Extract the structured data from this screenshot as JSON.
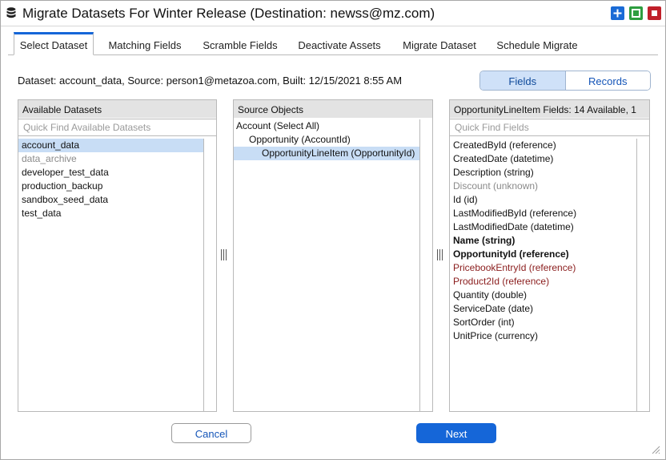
{
  "window": {
    "title": "Migrate Datasets For Winter Release (Destination: newss@mz.com)",
    "controls": {
      "plus": "+",
      "maximize": "maximize",
      "close": "close"
    }
  },
  "tabs": [
    {
      "label": "Select Dataset",
      "active": true
    },
    {
      "label": "Matching Fields",
      "active": false
    },
    {
      "label": "Scramble Fields",
      "active": false
    },
    {
      "label": "Deactivate Assets",
      "active": false
    },
    {
      "label": "Migrate Dataset",
      "active": false
    },
    {
      "label": "Schedule Migrate",
      "active": false
    }
  ],
  "dataset_info": "Dataset: account_data, Source: person1@metazoa.com, Built: 12/15/2021 8:55 AM",
  "view_toggle": {
    "fields": "Fields",
    "records": "Records",
    "selected": "Fields"
  },
  "available_datasets": {
    "header": "Available Datasets",
    "placeholder": "Quick Find Available Datasets",
    "items": [
      {
        "label": "account_data",
        "selected": true,
        "dim": false
      },
      {
        "label": "data_archive",
        "selected": false,
        "dim": true
      },
      {
        "label": "developer_test_data",
        "selected": false,
        "dim": false
      },
      {
        "label": "production_backup",
        "selected": false,
        "dim": false
      },
      {
        "label": "sandbox_seed_data",
        "selected": false,
        "dim": false
      },
      {
        "label": "test_data",
        "selected": false,
        "dim": false
      }
    ]
  },
  "source_objects": {
    "header": "Source Objects",
    "items": [
      {
        "label": "Account (Select All)",
        "indent": 0,
        "selected": false
      },
      {
        "label": "Opportunity (AccountId)",
        "indent": 1,
        "selected": false
      },
      {
        "label": "OpportunityLineItem (OpportunityId)",
        "indent": 2,
        "selected": true
      }
    ]
  },
  "fields_panel": {
    "header": "OpportunityLineItem Fields: 14 Available, 1",
    "placeholder": "Quick Find Fields",
    "items": [
      {
        "label": "CreatedById (reference)",
        "style": "normal"
      },
      {
        "label": "CreatedDate (datetime)",
        "style": "normal"
      },
      {
        "label": "Description (string)",
        "style": "normal"
      },
      {
        "label": "Discount (unknown)",
        "style": "dim"
      },
      {
        "label": "Id (id)",
        "style": "normal"
      },
      {
        "label": "LastModifiedById (reference)",
        "style": "normal"
      },
      {
        "label": "LastModifiedDate (datetime)",
        "style": "normal"
      },
      {
        "label": "Name (string)",
        "style": "bold"
      },
      {
        "label": "OpportunityId (reference)",
        "style": "bold"
      },
      {
        "label": "PricebookEntryId (reference)",
        "style": "red"
      },
      {
        "label": "Product2Id (reference)",
        "style": "red"
      },
      {
        "label": "Quantity (double)",
        "style": "normal"
      },
      {
        "label": "ServiceDate (date)",
        "style": "normal"
      },
      {
        "label": "SortOrder (int)",
        "style": "normal"
      },
      {
        "label": "UnitPrice (currency)",
        "style": "normal"
      }
    ]
  },
  "buttons": {
    "cancel": "Cancel",
    "next": "Next"
  },
  "colors": {
    "accent": "#1566d8",
    "selection": "#c8ddf5",
    "required_field": "#8a1c1c",
    "panel_header": "#e3e3e3"
  }
}
